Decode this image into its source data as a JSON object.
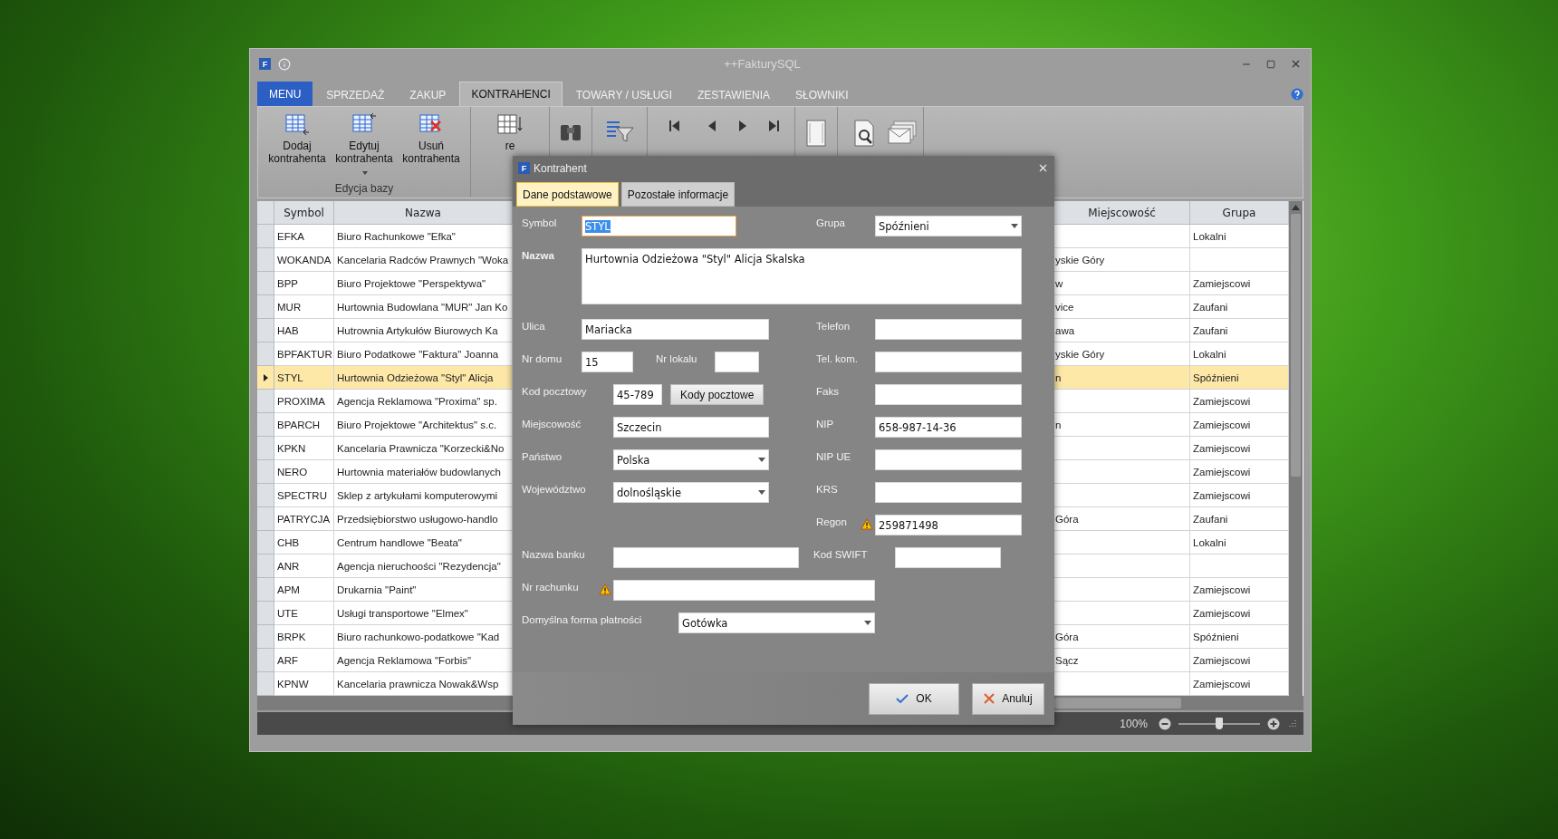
{
  "window": {
    "title": "++FakturySQL",
    "logo_letter": "F"
  },
  "tabs": [
    {
      "label": "MENU",
      "kind": "menu",
      "selected": false
    },
    {
      "label": "SPRZEDAŻ",
      "kind": "tab",
      "selected": false
    },
    {
      "label": "ZAKUP",
      "kind": "tab",
      "selected": false
    },
    {
      "label": "KONTRAHENCI",
      "kind": "tab",
      "selected": true
    },
    {
      "label": "TOWARY / USŁUGI",
      "kind": "tab",
      "selected": false
    },
    {
      "label": "ZESTAWIENIA",
      "kind": "tab",
      "selected": false
    },
    {
      "label": "SŁOWNIKI",
      "kind": "tab",
      "selected": false
    }
  ],
  "ribbon": {
    "groups": [
      {
        "label": "Edycja bazy",
        "buttons": [
          {
            "kind": "add",
            "label": "Dodaj kontrahenta",
            "dropdown": false
          },
          {
            "kind": "edit",
            "label": "Edytuj kontrahenta",
            "dropdown": true
          },
          {
            "kind": "delete",
            "label": "Usuń kontrahenta",
            "dropdown": false
          }
        ]
      },
      {
        "buttons": [
          {
            "kind": "sort",
            "label": "re",
            "dropdown": false
          }
        ]
      },
      {
        "buttons": [
          {
            "kind": "find"
          }
        ]
      },
      {
        "buttons": [
          {
            "kind": "filter"
          }
        ]
      },
      {
        "buttons": [
          {
            "kind": "first"
          },
          {
            "kind": "prev"
          },
          {
            "kind": "next"
          },
          {
            "kind": "last"
          }
        ]
      },
      {
        "buttons": [
          {
            "kind": "page"
          }
        ]
      },
      {
        "buttons": [
          {
            "kind": "preview"
          },
          {
            "kind": "mail"
          }
        ]
      }
    ]
  },
  "table": {
    "columns": [
      "Symbol",
      "Nazwa",
      "Miejscowość",
      "Grupa"
    ],
    "rows": [
      {
        "symbol": "EFKA",
        "nazwa": "Biuro Rachunkowe \"Efka\"",
        "miejscowosc": "",
        "grupa": "Lokalni",
        "selected": false
      },
      {
        "symbol": "WOKANDA",
        "nazwa": "Kancelaria Radców Prawnych \"Woka",
        "miejscowosc": "yskie Góry",
        "grupa": "",
        "selected": false
      },
      {
        "symbol": "BPP",
        "nazwa": "Biuro Projektowe \"Perspektywa\"",
        "miejscowosc": "w",
        "grupa": "Zamiejscowi",
        "selected": false
      },
      {
        "symbol": "MUR",
        "nazwa": "Hurtownia Budowlana \"MUR\" Jan Ko",
        "miejscowosc": "vice",
        "grupa": "Zaufani",
        "selected": false
      },
      {
        "symbol": "HAB",
        "nazwa": "Hutrownia Artykułów Biurowych Ka",
        "miejscowosc": "awa",
        "grupa": "Zaufani",
        "selected": false
      },
      {
        "symbol": "BPFAKTUR",
        "nazwa": "Biuro Podatkowe \"Faktura\" Joanna",
        "miejscowosc": "yskie Góry",
        "grupa": "Lokalni",
        "selected": false
      },
      {
        "symbol": "STYL",
        "nazwa": "Hurtownia Odzieżowa \"Styl\" Alicja",
        "miejscowosc": "n",
        "grupa": "Spóźnieni",
        "selected": true
      },
      {
        "symbol": "PROXIMA",
        "nazwa": "Agencja Reklamowa \"Proxima\" sp.",
        "miejscowosc": "",
        "grupa": "Zamiejscowi",
        "selected": false
      },
      {
        "symbol": "BPARCH",
        "nazwa": "Biuro Projektowe \"Architektus\" s.c.",
        "miejscowosc": "n",
        "grupa": "Zamiejscowi",
        "selected": false
      },
      {
        "symbol": "KPKN",
        "nazwa": "Kancelaria Prawnicza \"Korzecki&No",
        "miejscowosc": "",
        "grupa": "Zamiejscowi",
        "selected": false
      },
      {
        "symbol": "NERO",
        "nazwa": "Hurtownia materiałów budowlanych",
        "miejscowosc": "",
        "grupa": "Zamiejscowi",
        "selected": false
      },
      {
        "symbol": "SPECTRU",
        "nazwa": "Sklep z artykułami komputerowymi",
        "miejscowosc": "",
        "grupa": "Zamiejscowi",
        "selected": false
      },
      {
        "symbol": "PATRYCJA",
        "nazwa": "Przedsiębiorstwo usługowo-handlo",
        "miejscowosc": "Góra",
        "grupa": "Zaufani",
        "selected": false
      },
      {
        "symbol": "CHB",
        "nazwa": "Centrum handlowe \"Beata\"",
        "miejscowosc": "",
        "grupa": "Lokalni",
        "selected": false
      },
      {
        "symbol": "ANR",
        "nazwa": "Agencja nieruchoości \"Rezydencja\"",
        "miejscowosc": "",
        "grupa": "",
        "selected": false
      },
      {
        "symbol": "APM",
        "nazwa": "Drukarnia \"Paint\"",
        "miejscowosc": "",
        "grupa": "Zamiejscowi",
        "selected": false
      },
      {
        "symbol": "UTE",
        "nazwa": "Usługi transportowe \"Elmex\"",
        "miejscowosc": "",
        "grupa": "Zamiejscowi",
        "selected": false
      },
      {
        "symbol": "BRPK",
        "nazwa": "Biuro rachunkowo-podatkowe \"Kad",
        "miejscowosc": "Góra",
        "grupa": "Spóźnieni",
        "selected": false
      },
      {
        "symbol": "ARF",
        "nazwa": "Agencja Reklamowa \"Forbis\"",
        "miejscowosc": "Sącz",
        "grupa": "Zamiejscowi",
        "selected": false
      },
      {
        "symbol": "KPNW",
        "nazwa": "Kancelaria prawnicza Nowak&Wsp",
        "miejscowosc": "",
        "grupa": "Zamiejscowi",
        "selected": false
      }
    ]
  },
  "status_bar": {
    "zoom": {
      "reading": "100%",
      "level": 0.5
    }
  },
  "dialog": {
    "title": "Kontrahent",
    "logo_letter": "F",
    "tabs": [
      {
        "label": "Dane podstawowe",
        "selected": true
      },
      {
        "label": "Pozostałe informacje",
        "selected": false
      }
    ],
    "symbol": {
      "label": "Symbol",
      "value": "STYL",
      "highlighted": true
    },
    "grupa": {
      "label": "Grupa",
      "value": "Spóźnieni"
    },
    "nazwa": {
      "label": "Nazwa",
      "value": "Hurtownia Odzieżowa \"Styl\" Alicja Skalska"
    },
    "ulica": {
      "label": "Ulica",
      "value": "Mariacka"
    },
    "telefon": {
      "label": "Telefon"
    },
    "nr_domu": {
      "label": "Nr domu",
      "value": "15"
    },
    "nr_lokalu": {
      "label": "Nr lokalu"
    },
    "tel_kom": {
      "label": "Tel. kom."
    },
    "kod_pocztowy": {
      "label": "Kod pocztowy",
      "value": "45-789"
    },
    "kody_button": "Kody pocztowe",
    "faks": {
      "label": "Faks"
    },
    "miejscowosc": {
      "label": "Miejscowość",
      "value": "Szczecin"
    },
    "nip": {
      "label": "NIP",
      "value": "658-987-14-36"
    },
    "panstwo": {
      "label": "Państwo",
      "value": "Polska"
    },
    "nip_ue": {
      "label": "NIP UE"
    },
    "wojewodztwo": {
      "label": "Województwo",
      "value": "dolnośląskie"
    },
    "krs": {
      "label": "KRS"
    },
    "regon": {
      "label": "Regon",
      "value": "259871498",
      "warning": true
    },
    "nazwa_banku": {
      "label": "Nazwa banku"
    },
    "kod_swift": {
      "label": "Kod SWIFT"
    },
    "nr_rachunku": {
      "label": "Nr rachunku",
      "warning": true
    },
    "forma_platnosci": {
      "label": "Domyślna forma płatności",
      "value": "Gotówka"
    },
    "ok": "OK",
    "cancel": "Anuluj"
  }
}
